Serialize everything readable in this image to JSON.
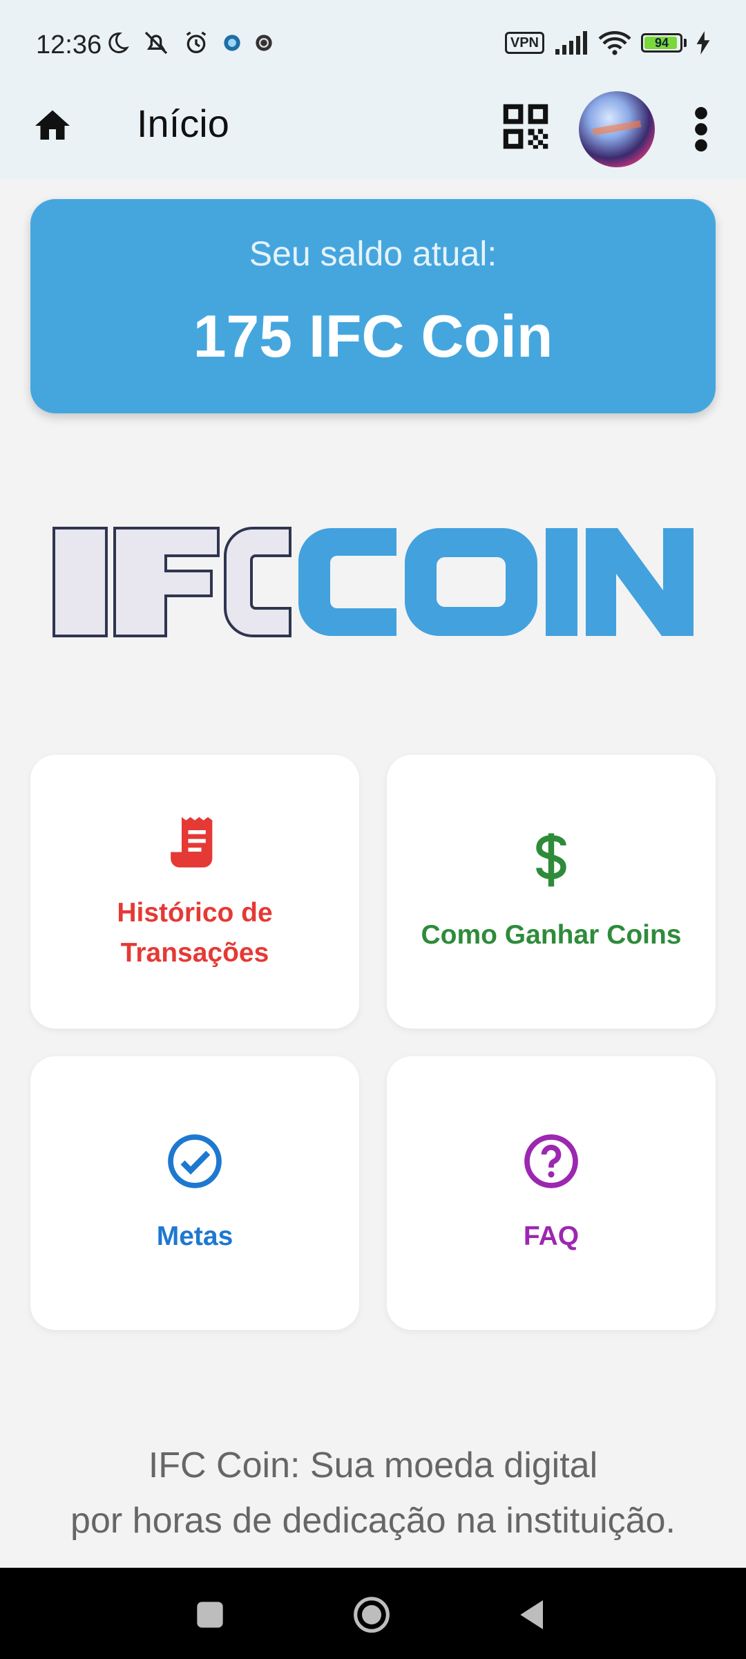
{
  "status_bar": {
    "time": "12:36",
    "vpn_label": "VPN",
    "battery_level": "94",
    "battery_fraction": 0.94
  },
  "app_bar": {
    "title": "Início"
  },
  "balance": {
    "label": "Seu saldo atual:",
    "value": "175 IFC Coin"
  },
  "logo": {
    "text_left": "IFC",
    "text_right": "COIN"
  },
  "tiles": [
    {
      "label": "Histórico de Transações",
      "icon": "receipt-icon",
      "color": "#e53935"
    },
    {
      "label": "Como Ganhar Coins",
      "icon": "dollar-icon",
      "color": "#2e8b3a"
    },
    {
      "label": "Metas",
      "icon": "check-circle-icon",
      "color": "#1e78d0"
    },
    {
      "label": "FAQ",
      "icon": "help-circle-icon",
      "color": "#9c27b0"
    }
  ],
  "footer": {
    "line1": "IFC Coin: Sua moeda digital",
    "line2": "por horas de dedicação na instituição."
  },
  "colors": {
    "accent": "#45a6de",
    "appbar_bg": "#eaf2f5",
    "page_bg": "#f3f3f3"
  }
}
